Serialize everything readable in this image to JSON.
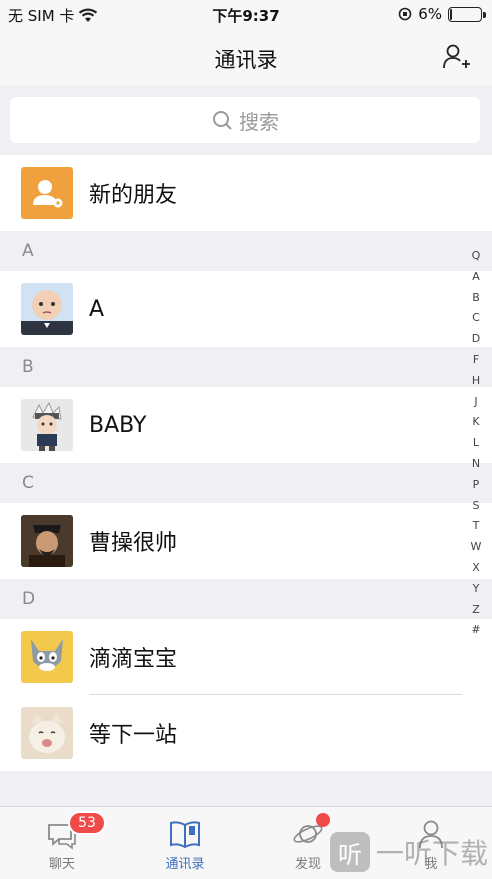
{
  "status_bar": {
    "carrier": "无 SIM 卡",
    "time": "下午9:37",
    "battery": "6%",
    "battery_level": 0.06
  },
  "navbar": {
    "title": "通讯录",
    "add_icon": "add-contact-icon"
  },
  "search": {
    "placeholder": "搜索",
    "icon": "search-icon"
  },
  "new_friends": {
    "label": "新的朋友",
    "icon": "new-friend-icon",
    "color": "#f0a03c"
  },
  "sections": [
    {
      "letter": "A",
      "contacts": [
        {
          "name": "A"
        }
      ]
    },
    {
      "letter": "B",
      "contacts": [
        {
          "name": "BABY"
        }
      ]
    },
    {
      "letter": "C",
      "contacts": [
        {
          "name": "曹操很帅"
        }
      ]
    },
    {
      "letter": "D",
      "contacts": [
        {
          "name": "滴滴宝宝"
        },
        {
          "name": "等下一站"
        }
      ]
    }
  ],
  "index_letters": [
    "Q",
    "A",
    "B",
    "C",
    "D",
    "F",
    "H",
    "J",
    "K",
    "L",
    "N",
    "P",
    "S",
    "T",
    "W",
    "X",
    "Y",
    "Z",
    "#"
  ],
  "tabbar": {
    "tabs": [
      {
        "label": "聊天",
        "icon": "chat-icon",
        "badge": "53"
      },
      {
        "label": "通讯录",
        "icon": "contacts-book-icon",
        "active": true
      },
      {
        "label": "发现",
        "icon": "discover-planet-icon"
      },
      {
        "label": "我",
        "icon": "me-person-icon"
      }
    ],
    "active_color": "#3f6fbf",
    "badge_color": "#f04a4a"
  },
  "watermark": {
    "logo_text": "听",
    "text": "一听下载"
  }
}
